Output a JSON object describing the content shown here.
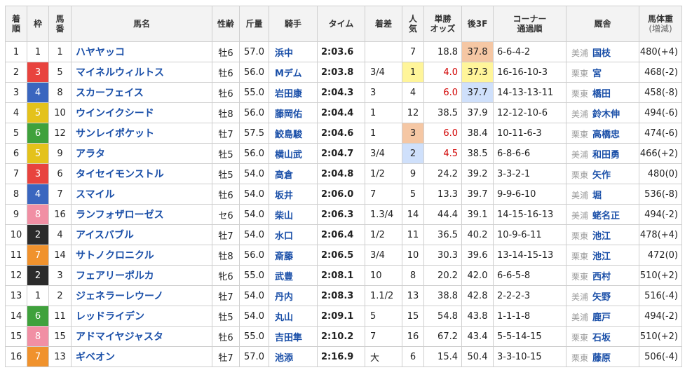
{
  "headers": {
    "rank": [
      "着",
      "順"
    ],
    "waku": "枠",
    "umaban": [
      "馬",
      "番"
    ],
    "name": "馬名",
    "sexage": "性齢",
    "weight": "斤量",
    "jockey": "騎手",
    "time": "タイム",
    "margin": "着差",
    "pop": [
      "人",
      "気"
    ],
    "odds": [
      "単勝",
      "オッズ"
    ],
    "last3f": "後3F",
    "corner": [
      "コーナー",
      "通過順"
    ],
    "stable": "厩舎",
    "bodyweight": [
      "馬体重",
      "(増減)"
    ]
  },
  "colors": {
    "waku": {
      "1": {
        "bg": "#ffffff",
        "fg": "#222222"
      },
      "2": {
        "bg": "#2b2b2b",
        "fg": "#ffffff"
      },
      "3": {
        "bg": "#e8433e",
        "fg": "#ffffff"
      },
      "4": {
        "bg": "#3a66bf",
        "fg": "#ffffff"
      },
      "5": {
        "bg": "#e4c21b",
        "fg": "#ffffff"
      },
      "6": {
        "bg": "#3fa13c",
        "fg": "#ffffff"
      },
      "7": {
        "bg": "#f0922d",
        "fg": "#ffffff"
      },
      "8": {
        "bg": "#f18fa4",
        "fg": "#ffffff"
      }
    },
    "pop1": "#fff59a",
    "pop2": "#cfe0fb",
    "pop3": "#f5c7a4",
    "f3_1": "#f5c7a4",
    "f3_2": "#fff59a",
    "f3_3": "#cfe0fb"
  },
  "rows": [
    {
      "rank": "1",
      "waku": "1",
      "umaban": "1",
      "name": "ハヤヤッコ",
      "sexage": "牡6",
      "weight": "57.0",
      "jockey": "浜中",
      "time": "2:03.6",
      "margin": "",
      "pop": "7",
      "odds": "18.8",
      "odds_red": false,
      "pop_hl": "",
      "last3f": "37.8",
      "f3_hl": "f3_1",
      "corner": "6-6-4-2",
      "ew": "美浦",
      "trainer": "国枝",
      "bw": "480(+4)"
    },
    {
      "rank": "2",
      "waku": "3",
      "umaban": "5",
      "name": "マイネルウィルトス",
      "sexage": "牡6",
      "weight": "56.0",
      "jockey": "Mデム",
      "time": "2:03.8",
      "margin": "3/4",
      "pop": "1",
      "odds": "4.0",
      "odds_red": true,
      "pop_hl": "pop1",
      "last3f": "37.3",
      "f3_hl": "f3_2",
      "corner": "16-16-10-3",
      "ew": "栗東",
      "trainer": "宮",
      "bw": "468(-2)"
    },
    {
      "rank": "3",
      "waku": "4",
      "umaban": "8",
      "name": "スカーフェイス",
      "sexage": "牡6",
      "weight": "55.0",
      "jockey": "岩田康",
      "time": "2:04.3",
      "margin": "3",
      "pop": "4",
      "odds": "6.0",
      "odds_red": true,
      "pop_hl": "",
      "last3f": "37.7",
      "f3_hl": "f3_3",
      "corner": "14-13-13-11",
      "ew": "栗東",
      "trainer": "橋田",
      "bw": "458(-8)"
    },
    {
      "rank": "4",
      "waku": "5",
      "umaban": "10",
      "name": "ウインイクシード",
      "sexage": "牡8",
      "weight": "56.0",
      "jockey": "藤岡佑",
      "time": "2:04.4",
      "margin": "1",
      "pop": "12",
      "odds": "38.5",
      "odds_red": false,
      "pop_hl": "",
      "last3f": "37.9",
      "f3_hl": "",
      "corner": "12-12-10-6",
      "ew": "美浦",
      "trainer": "鈴木伸",
      "bw": "494(-6)"
    },
    {
      "rank": "5",
      "waku": "6",
      "umaban": "12",
      "name": "サンレイポケット",
      "sexage": "牡7",
      "weight": "57.5",
      "jockey": "鮫島駿",
      "time": "2:04.6",
      "margin": "1",
      "pop": "3",
      "odds": "6.0",
      "odds_red": true,
      "pop_hl": "pop3",
      "last3f": "38.4",
      "f3_hl": "",
      "corner": "10-11-6-3",
      "ew": "栗東",
      "trainer": "高橋忠",
      "bw": "474(-6)"
    },
    {
      "rank": "6",
      "waku": "5",
      "umaban": "9",
      "name": "アラタ",
      "sexage": "牡5",
      "weight": "56.0",
      "jockey": "横山武",
      "time": "2:04.7",
      "margin": "3/4",
      "pop": "2",
      "odds": "4.5",
      "odds_red": true,
      "pop_hl": "pop2",
      "last3f": "38.5",
      "f3_hl": "",
      "corner": "6-8-6-6",
      "ew": "美浦",
      "trainer": "和田勇",
      "bw": "466(+2)"
    },
    {
      "rank": "7",
      "waku": "3",
      "umaban": "6",
      "name": "タイセイモンストル",
      "sexage": "牡5",
      "weight": "54.0",
      "jockey": "高倉",
      "time": "2:04.8",
      "margin": "1/2",
      "pop": "9",
      "odds": "24.2",
      "odds_red": false,
      "pop_hl": "",
      "last3f": "39.2",
      "f3_hl": "",
      "corner": "3-3-2-1",
      "ew": "栗東",
      "trainer": "矢作",
      "bw": "480(0)"
    },
    {
      "rank": "8",
      "waku": "4",
      "umaban": "7",
      "name": "スマイル",
      "sexage": "牡6",
      "weight": "54.0",
      "jockey": "坂井",
      "time": "2:06.0",
      "margin": "7",
      "pop": "5",
      "odds": "13.3",
      "odds_red": false,
      "pop_hl": "",
      "last3f": "39.7",
      "f3_hl": "",
      "corner": "9-9-6-10",
      "ew": "美浦",
      "trainer": "堀",
      "bw": "536(-8)"
    },
    {
      "rank": "9",
      "waku": "8",
      "umaban": "16",
      "name": "ランフォザローゼス",
      "sexage": "セ6",
      "weight": "54.0",
      "jockey": "柴山",
      "time": "2:06.3",
      "margin": "1.3/4",
      "pop": "14",
      "odds": "44.4",
      "odds_red": false,
      "pop_hl": "",
      "last3f": "39.1",
      "f3_hl": "",
      "corner": "14-15-16-13",
      "ew": "美浦",
      "trainer": "蛯名正",
      "bw": "494(-2)"
    },
    {
      "rank": "10",
      "waku": "2",
      "umaban": "4",
      "name": "アイスバブル",
      "sexage": "牡7",
      "weight": "54.0",
      "jockey": "水口",
      "time": "2:06.4",
      "margin": "1/2",
      "pop": "11",
      "odds": "36.5",
      "odds_red": false,
      "pop_hl": "",
      "last3f": "40.2",
      "f3_hl": "",
      "corner": "10-9-6-11",
      "ew": "栗東",
      "trainer": "池江",
      "bw": "478(+4)"
    },
    {
      "rank": "11",
      "waku": "7",
      "umaban": "14",
      "name": "サトノクロニクル",
      "sexage": "牡8",
      "weight": "56.0",
      "jockey": "斎藤",
      "time": "2:06.5",
      "margin": "3/4",
      "pop": "10",
      "odds": "30.3",
      "odds_red": false,
      "pop_hl": "",
      "last3f": "39.6",
      "f3_hl": "",
      "corner": "13-14-15-13",
      "ew": "栗東",
      "trainer": "池江",
      "bw": "472(0)"
    },
    {
      "rank": "12",
      "waku": "2",
      "umaban": "3",
      "name": "フェアリーポルカ",
      "sexage": "牝6",
      "weight": "55.0",
      "jockey": "武豊",
      "time": "2:08.1",
      "margin": "10",
      "pop": "8",
      "odds": "20.2",
      "odds_red": false,
      "pop_hl": "",
      "last3f": "42.0",
      "f3_hl": "",
      "corner": "6-6-5-8",
      "ew": "栗東",
      "trainer": "西村",
      "bw": "510(+2)"
    },
    {
      "rank": "13",
      "waku": "1",
      "umaban": "2",
      "name": "ジェネラーレウーノ",
      "sexage": "牡7",
      "weight": "54.0",
      "jockey": "丹内",
      "time": "2:08.3",
      "margin": "1.1/2",
      "pop": "13",
      "odds": "38.8",
      "odds_red": false,
      "pop_hl": "",
      "last3f": "42.8",
      "f3_hl": "",
      "corner": "2-2-2-3",
      "ew": "美浦",
      "trainer": "矢野",
      "bw": "516(-4)"
    },
    {
      "rank": "14",
      "waku": "6",
      "umaban": "11",
      "name": "レッドライデン",
      "sexage": "牡5",
      "weight": "54.0",
      "jockey": "丸山",
      "time": "2:09.1",
      "margin": "5",
      "pop": "15",
      "odds": "54.8",
      "odds_red": false,
      "pop_hl": "",
      "last3f": "43.8",
      "f3_hl": "",
      "corner": "1-1-1-8",
      "ew": "美浦",
      "trainer": "鹿戸",
      "bw": "494(-2)"
    },
    {
      "rank": "15",
      "waku": "8",
      "umaban": "15",
      "name": "アドマイヤジャスタ",
      "sexage": "牡6",
      "weight": "55.0",
      "jockey": "吉田隼",
      "time": "2:10.2",
      "margin": "7",
      "pop": "16",
      "odds": "67.2",
      "odds_red": false,
      "pop_hl": "",
      "last3f": "43.4",
      "f3_hl": "",
      "corner": "5-5-14-15",
      "ew": "栗東",
      "trainer": "石坂",
      "bw": "510(+2)"
    },
    {
      "rank": "16",
      "waku": "7",
      "umaban": "13",
      "name": "ギベオン",
      "sexage": "牡7",
      "weight": "57.0",
      "jockey": "池添",
      "time": "2:16.9",
      "margin": "大",
      "pop": "6",
      "odds": "15.4",
      "odds_red": false,
      "pop_hl": "",
      "last3f": "50.4",
      "f3_hl": "",
      "corner": "3-3-10-15",
      "ew": "栗東",
      "trainer": "藤原",
      "bw": "506(-4)"
    }
  ]
}
